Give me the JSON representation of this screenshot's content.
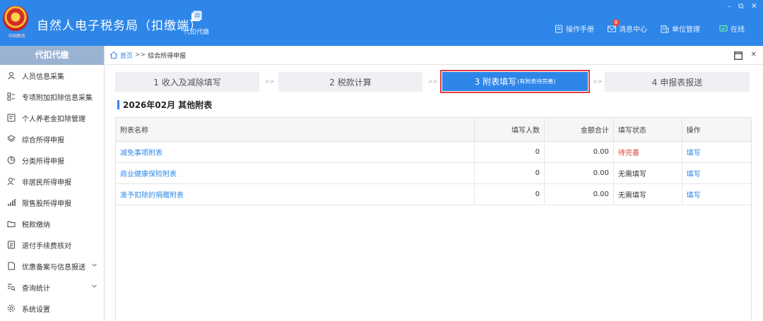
{
  "header": {
    "emblem_text": "中国税务",
    "title": "自然人电子税务局（扣缴端）",
    "tool_label": "代扣代缴",
    "links": {
      "manual": "操作手册",
      "messages": "消息中心",
      "org": "单位管理",
      "online": "在线"
    },
    "message_count": "8",
    "window_controls": {
      "minimize": "–",
      "restore": "⧉",
      "close": "✕"
    }
  },
  "sidebar": {
    "title": "代扣代缴",
    "items": [
      {
        "label": "人员信息采集",
        "icon": "person-icon"
      },
      {
        "label": "专项附加扣除信息采集",
        "icon": "grid-list-icon"
      },
      {
        "label": "个人养老金扣除管理",
        "icon": "id-card-icon"
      },
      {
        "label": "综合所得申报",
        "icon": "layers-icon"
      },
      {
        "label": "分类所得申报",
        "icon": "pie-icon"
      },
      {
        "label": "非居民所得申报",
        "icon": "person-outline-icon"
      },
      {
        "label": "限售股所得申报",
        "icon": "bar-chart-icon"
      },
      {
        "label": "税款缴纳",
        "icon": "folder-icon"
      },
      {
        "label": "退付手续费核对",
        "icon": "document-icon"
      },
      {
        "label": "优惠备案与信息报送",
        "icon": "file-icon"
      },
      {
        "label": "查询统计",
        "icon": "search-list-icon"
      },
      {
        "label": "系统设置",
        "icon": "gear-icon"
      }
    ]
  },
  "breadcrumb": {
    "home": "首页",
    "sep": ">>",
    "current": "综合所得申报"
  },
  "steps": [
    {
      "label": "1 收入及减除填写",
      "sub": ""
    },
    {
      "label": "2 税款计算",
      "sub": ""
    },
    {
      "label": "3 附表填写",
      "sub": "(有附表待完善)"
    },
    {
      "label": "4 申报表报送",
      "sub": ""
    }
  ],
  "step_arrow": ">>",
  "section_title": "2026年02月 其他附表",
  "table": {
    "headers": [
      "附表名称",
      "填写人数",
      "金额合计",
      "填写状态",
      "操作"
    ],
    "rows": [
      {
        "name": "减免事项附表",
        "count": "0",
        "amount": "0.00",
        "status": "待完善",
        "action": "填写"
      },
      {
        "name": "商业健康保险附表",
        "count": "0",
        "amount": "0.00",
        "status": "无需填写",
        "action": "填写"
      },
      {
        "name": "准予扣除的捐赠附表",
        "count": "0",
        "amount": "0.00",
        "status": "无需填写",
        "action": "填写"
      }
    ]
  },
  "colors": {
    "brand": "#2d86e8",
    "sidebar_head": "#9ab3d3",
    "alert": "#e23b3b"
  }
}
